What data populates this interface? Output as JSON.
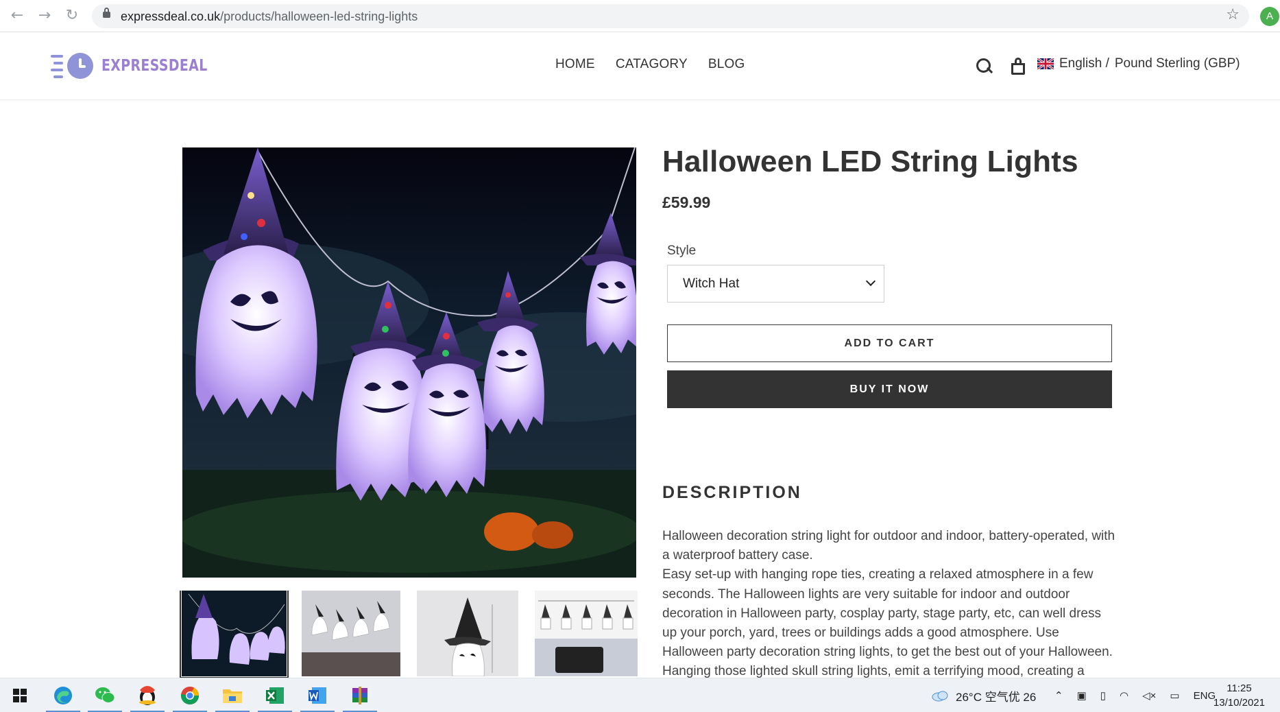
{
  "browser": {
    "url_domain": "expressdeal.co.uk",
    "url_path": "/products/halloween-led-string-lights",
    "profile_initial": "A",
    "icons": [
      "back-icon",
      "forward-icon",
      "reload-icon",
      "lock-icon",
      "star-icon"
    ]
  },
  "header": {
    "logo_text": "EXPRESSDEAL",
    "nav": [
      "HOME",
      "CATAGORY",
      "BLOG"
    ],
    "language": "English /",
    "currency": "Pound Sterling (GBP)"
  },
  "product": {
    "title": "Halloween LED String Lights",
    "price": "£59.99",
    "style_label": "Style",
    "style_value": "Witch Hat",
    "add_to_cart": "ADD TO CART",
    "buy_now": "BUY IT NOW",
    "description_heading": "DESCRIPTION",
    "description_p1": "Halloween decoration string light for outdoor and indoor, battery-operated, with a waterproof battery case.",
    "description_p2": "Easy set-up with hanging rope ties, creating a relaxed atmosphere in a few seconds. The Halloween lights are very suitable for indoor and outdoor decoration in Halloween party, cosplay party, stage party, etc, can well dress up your porch, yard, trees or buildings adds a good atmosphere. Use Halloween party decoration string lights, to get the best out of your Halloween. Hanging those lighted skull string lights, emit a terrifying mood, creating a terror"
  },
  "taskbar": {
    "weather": "26°C 空气优 26",
    "lang": "ENG",
    "time": "11:25",
    "date": "13/10/2021"
  },
  "colors": {
    "accent": "#9b7fd0",
    "button_dark": "#333333"
  }
}
